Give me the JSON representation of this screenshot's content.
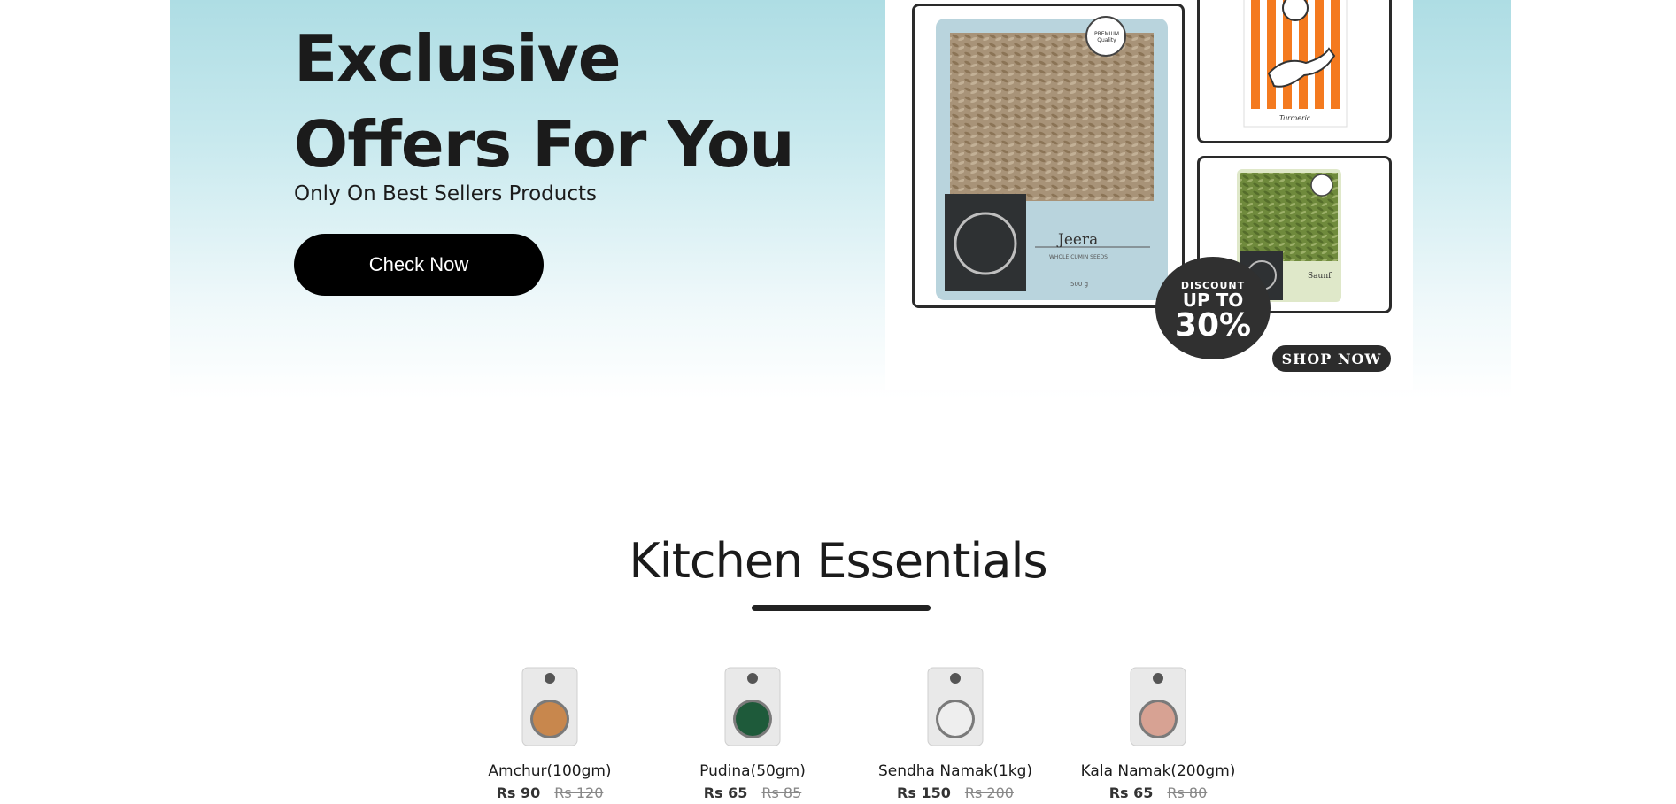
{
  "hero": {
    "title_line1": "Exclusive",
    "title_line2": "Offers For You",
    "subtitle": "Only On Best Sellers Products",
    "button_label": "Check Now"
  },
  "banner": {
    "jeera_label": "Jeera",
    "jeera_sub": "WHOLE CUMIN SEEDS",
    "jeera_weight": "500 g",
    "premium_badge": "PREMIUM Quality",
    "turmeric_label": "Turmeric",
    "saunf_label": "Saunf",
    "discount_line1": "DISCOUNT",
    "discount_line2": "UP TO",
    "discount_line3": "30%",
    "shop_now": "SHOP NOW"
  },
  "section": {
    "title": "Kitchen Essentials"
  },
  "products": [
    {
      "name": "Amchur(100gm)",
      "price": "Rs 90",
      "old_price": "Rs 120",
      "color": "#c8874d"
    },
    {
      "name": "Pudina(50gm)",
      "price": "Rs 65",
      "old_price": "Rs 85",
      "color": "#1e5a3a"
    },
    {
      "name": "Sendha Namak(1kg)",
      "price": "Rs 150",
      "old_price": "Rs 200",
      "color": "#eeeeee"
    },
    {
      "name": "Kala Namak(200gm)",
      "price": "Rs 65",
      "old_price": "Rs 80",
      "color": "#d7a293"
    }
  ]
}
